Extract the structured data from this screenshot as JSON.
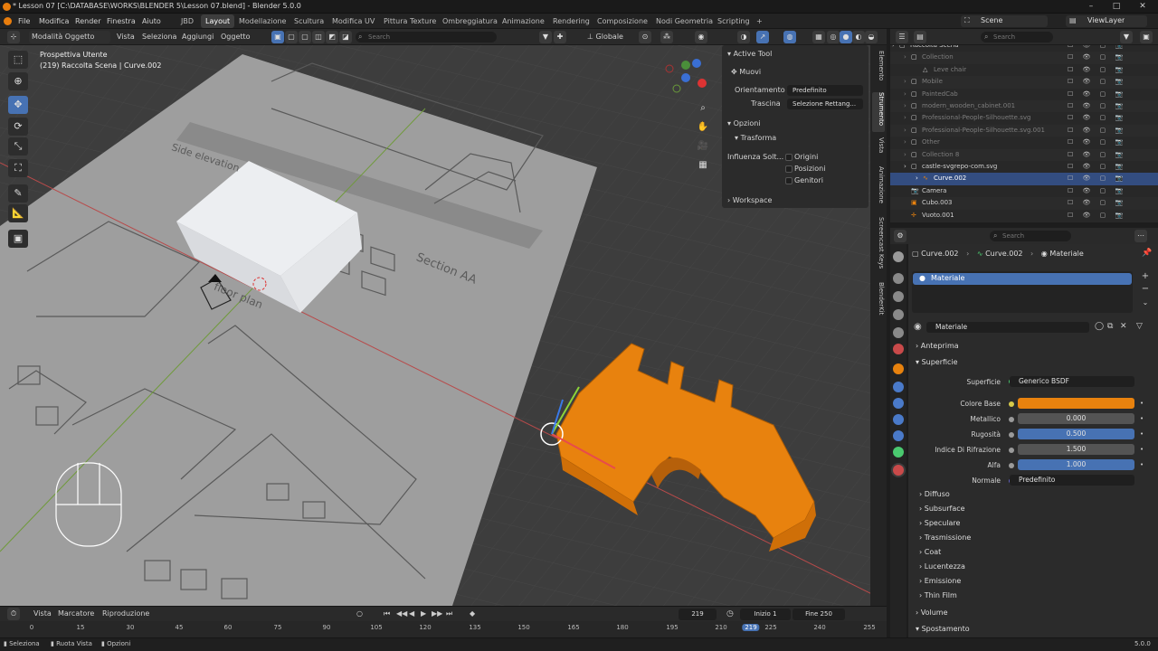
{
  "window": {
    "title": "* Lesson 07 [C:\\DATABASE\\WORKS\\BLENDER 5\\Lesson 07.blend] - Blender 5.0.0",
    "controls": [
      "–",
      "□",
      "✕"
    ]
  },
  "menu": [
    "File",
    "Modifica",
    "Render",
    "Finestra",
    "Aiuto"
  ],
  "workspaces": [
    "JBD",
    "Layout",
    "Modellazione",
    "Scultura",
    "Modifica UV",
    "Pittura Texture",
    "Ombreggiatura",
    "Animazione",
    "Rendering",
    "Composizione",
    "Nodi Geometria",
    "Scripting",
    "+"
  ],
  "active_workspace": "Layout",
  "scene": {
    "scene_label": "Scene",
    "view_layer": "ViewLayer"
  },
  "viewport_header": {
    "mode": "Modalità Oggetto",
    "menus": [
      "Vista",
      "Seleziona",
      "Aggiungi",
      "Oggetto"
    ],
    "search_placeholder": "Search",
    "orientation": "Globale"
  },
  "viewport": {
    "view_name": "Prospettiva Utente",
    "context": "(219) Raccolta Scena | Curve.002",
    "sheet_texts": [
      "Side elevation",
      "Section AA",
      "floor plan"
    ]
  },
  "npanel": {
    "active_tool_title": "Active Tool",
    "tool_name": "Muovi",
    "orientation_label": "Orientamento",
    "orientation_value": "Predefinito",
    "drag_label": "Trascina",
    "drag_value": "Selezione Rettang...",
    "options_title": "Opzioni",
    "transform_title": "Trasforma",
    "affect_label": "Influenza Solt...",
    "affect_items": [
      "Origini",
      "Posizioni",
      "Genitori"
    ],
    "workspace_title": "Workspace",
    "tabs": [
      "Elemento",
      "Strumento",
      "Vista",
      "Animazione",
      "Screencast Keys",
      "BlenderKit"
    ],
    "active_tab": "Strumento"
  },
  "outliner": {
    "search_placeholder": "Search",
    "rows": [
      {
        "name": "Raccolta Scena",
        "indent": 0,
        "type": "collection",
        "dim": false
      },
      {
        "name": "Collection",
        "indent": 1,
        "type": "collection",
        "dim": true
      },
      {
        "name": "Leve chair",
        "indent": 2,
        "type": "object",
        "dim": true
      },
      {
        "name": "Mobile",
        "indent": 1,
        "type": "collection",
        "dim": true
      },
      {
        "name": "PaintedCab",
        "indent": 1,
        "type": "collection",
        "dim": true
      },
      {
        "name": "modern_wooden_cabinet.001",
        "indent": 1,
        "type": "collection",
        "dim": true
      },
      {
        "name": "Professional-People-Silhouette.svg",
        "indent": 1,
        "type": "collection",
        "dim": true
      },
      {
        "name": "Professional-People-Silhouette.svg.001",
        "indent": 1,
        "type": "collection",
        "dim": true
      },
      {
        "name": "Other",
        "indent": 1,
        "type": "collection",
        "dim": true
      },
      {
        "name": "Collection 8",
        "indent": 1,
        "type": "collection",
        "dim": true
      },
      {
        "name": "castle-svgrepo-com.svg",
        "indent": 1,
        "type": "collection",
        "dim": false
      },
      {
        "name": "Curve.002",
        "indent": 2,
        "type": "curve",
        "dim": false,
        "selected": true
      },
      {
        "name": "Camera",
        "indent": 1,
        "type": "camera",
        "dim": false
      },
      {
        "name": "Cubo.003",
        "indent": 1,
        "type": "mesh",
        "dim": false
      },
      {
        "name": "Vuoto.001",
        "indent": 1,
        "type": "empty",
        "dim": false
      }
    ]
  },
  "properties": {
    "search_placeholder": "Search",
    "breadcrumb": [
      "Curve.002",
      "Curve.002",
      "Materiale"
    ],
    "slot_name": "Materiale",
    "material_name": "Materiale",
    "sections": {
      "preview": "Anteprima",
      "surface": "Superficie",
      "diffuse": "Diffuso",
      "subsurface": "Subsurface",
      "specular": "Speculare",
      "transmission": "Trasmissione",
      "coat": "Coat",
      "sheen": "Lucentezza",
      "emission": "Emissione",
      "thin_film": "Thin Film",
      "volume": "Volume",
      "displacement": "Spostamento"
    },
    "surface_label": "Superficie",
    "surface_value": "Generico BSDF",
    "fields": [
      {
        "label": "Colore Base",
        "value": "",
        "kind": "color"
      },
      {
        "label": "Metallico",
        "value": "0.000",
        "kind": "plain"
      },
      {
        "label": "Rugosità",
        "value": "0.500",
        "kind": "blue"
      },
      {
        "label": "Indice Di Rifrazione",
        "value": "1.500",
        "kind": "plain"
      },
      {
        "label": "Alfa",
        "value": "1.000",
        "kind": "blue"
      },
      {
        "label": "Normale",
        "value": "Predefinito",
        "kind": "dark"
      }
    ],
    "base_color": "#e8820e"
  },
  "timeline": {
    "menus": [
      "Vista",
      "Marcatore",
      "Riproduzione"
    ],
    "current_frame": "219",
    "start_label": "Inizio",
    "start_value": "1",
    "end_label": "Fine",
    "end_value": "250",
    "ticks": [
      "0",
      "15",
      "30",
      "45",
      "60",
      "75",
      "90",
      "105",
      "120",
      "135",
      "150",
      "165",
      "180",
      "195",
      "210",
      "219",
      "225",
      "240",
      "255"
    ]
  },
  "statusbar": {
    "items": [
      "Seleziona",
      "Ruota Vista",
      "Opzioni"
    ],
    "version": "5.0.0"
  },
  "colors": {
    "accent": "#4772b3",
    "object_orange": "#e8820e",
    "selected_row": "#334d80"
  }
}
